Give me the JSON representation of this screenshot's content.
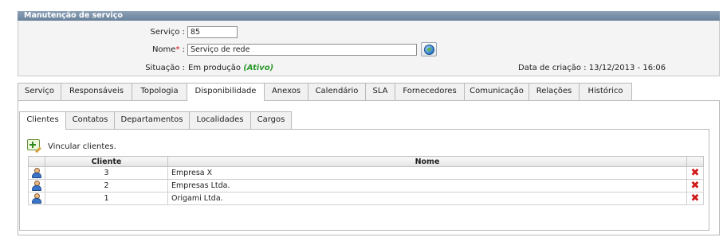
{
  "panel": {
    "title": "Manutenção de serviço"
  },
  "form": {
    "servico_label": "Serviço :",
    "servico_value": "85",
    "nome_label": "Nome",
    "nome_required": "*",
    "nome_colon": " :",
    "nome_value": "Serviço de rede",
    "situacao_label": "Situação :",
    "situacao_value": "Em produção",
    "situacao_status": "(Ativo)",
    "data_label": "Data de criação :",
    "data_value": "13/12/2013 - 16:06"
  },
  "main_tabs": [
    "Serviço",
    "Responsáveis",
    "Topologia",
    "Disponibilidade",
    "Anexos",
    "Calendário",
    "SLA",
    "Fornecedores",
    "Comunicação",
    "Relações",
    "Histórico"
  ],
  "active_main_tab": "Disponibilidade",
  "sub_tabs": [
    "Clientes",
    "Contatos",
    "Departamentos",
    "Localidades",
    "Cargos"
  ],
  "active_sub_tab": "Clientes",
  "link_label": "Vincular clientes.",
  "table": {
    "headers": {
      "cliente": "Cliente",
      "nome": "Nome"
    },
    "rows": [
      {
        "cliente": "3",
        "nome": "Empresa X"
      },
      {
        "cliente": "2",
        "nome": "Empresas Ltda."
      },
      {
        "cliente": "1",
        "nome": "Origami Ltda."
      }
    ]
  },
  "icons": {
    "row_icon": "user-icon",
    "delete_icon": "delete-icon",
    "add_icon": "add-link-icon",
    "web_icon": "globe-icon"
  },
  "colors": {
    "title_bar": "#7a91a8",
    "status_active": "#2a9a2a",
    "required": "#d00000",
    "delete": "#d01818"
  }
}
